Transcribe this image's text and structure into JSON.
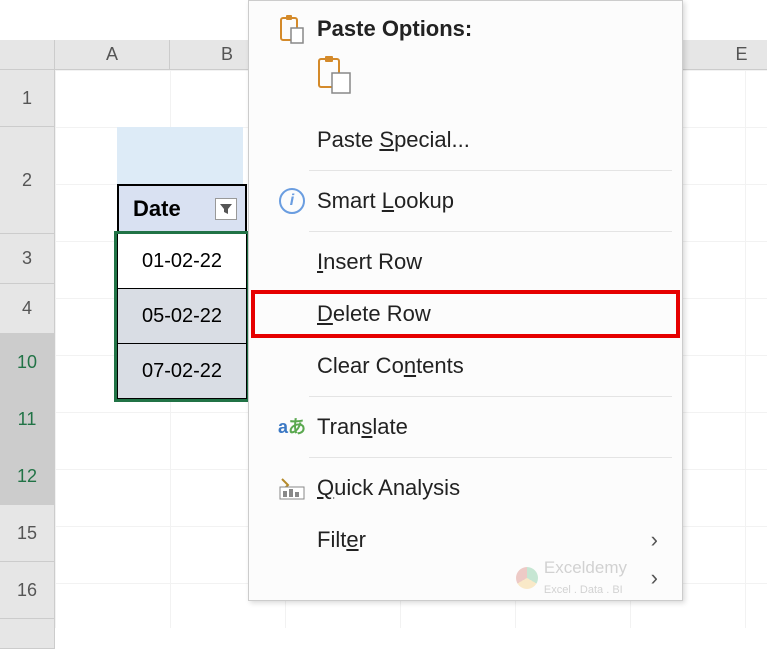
{
  "columns": {
    "A": "A",
    "B": "B",
    "E": "E"
  },
  "rows": {
    "r1": "1",
    "r2": "2",
    "r3": "3",
    "r4": "4",
    "r10": "10",
    "r11": "11",
    "r12": "12",
    "r15": "15",
    "r16": "16"
  },
  "title_visible_fragment": "D",
  "table": {
    "header": "Date",
    "cells": [
      "01-02-22",
      "05-02-22",
      "07-02-22"
    ]
  },
  "menu": {
    "paste_options": "Paste Options:",
    "paste_special": "Paste Special...",
    "smart_lookup": "Smart Lookup",
    "insert_row": "Insert Row",
    "delete_row": "Delete Row",
    "clear_contents": "Clear Contents",
    "translate": "Translate",
    "quick_analysis": "Quick Analysis",
    "filter": "Filter"
  },
  "watermark": {
    "line1": "Exceldemy",
    "line2": "Excel . Data . BI"
  }
}
